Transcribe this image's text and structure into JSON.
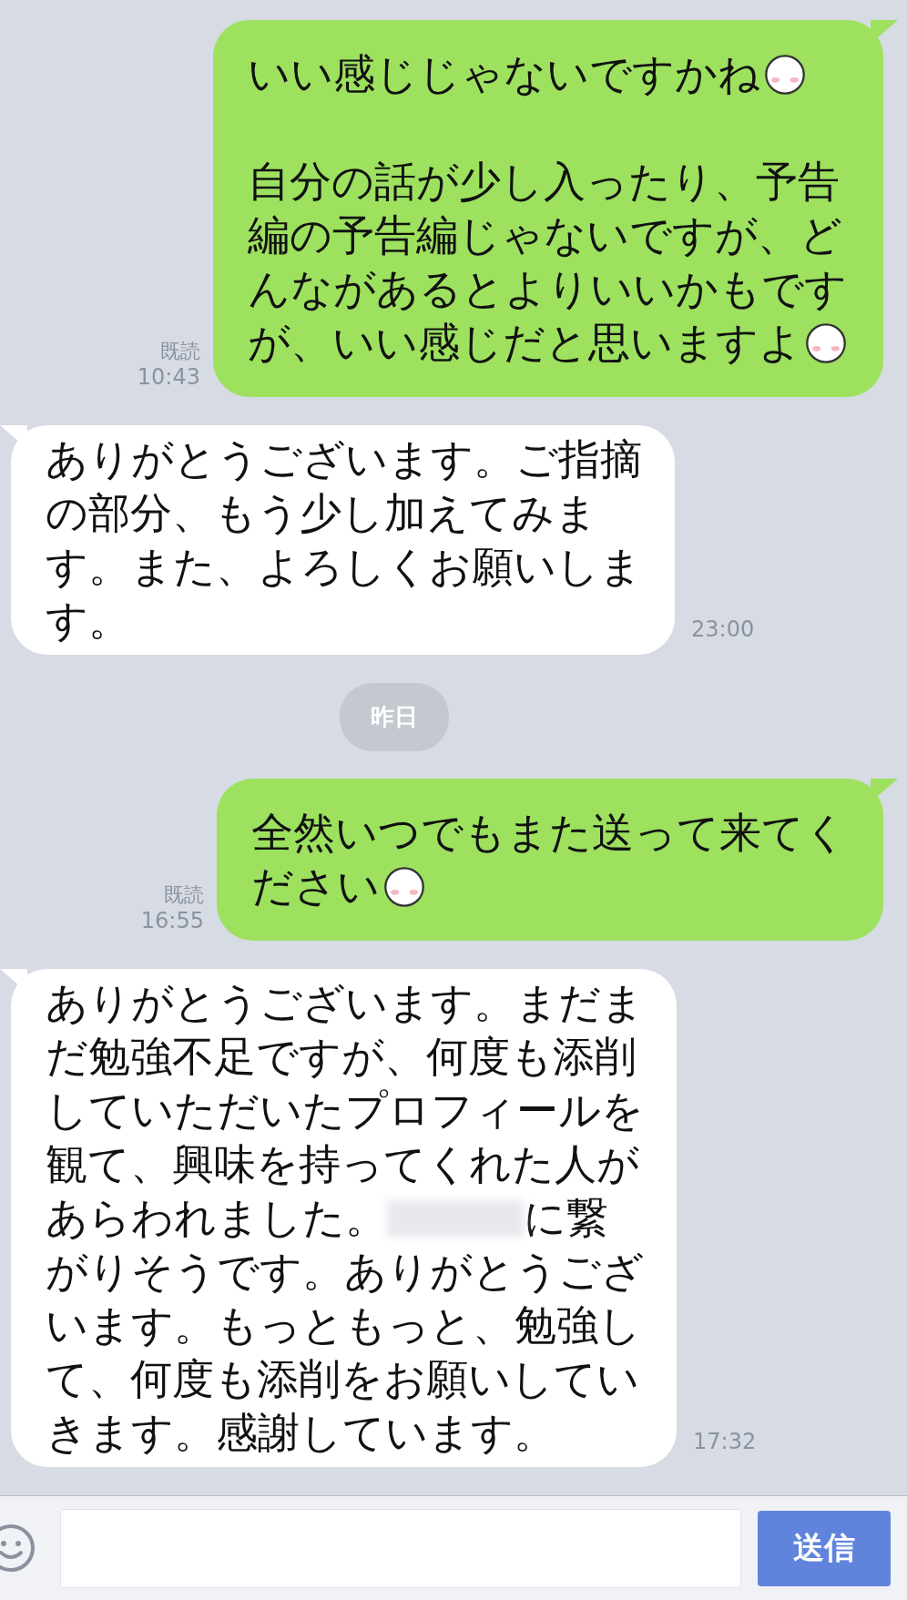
{
  "messages": [
    {
      "kind": "sent",
      "read": "既読",
      "time": "10:43",
      "paragraphs": [
        [
          [
            {
              "kind": "text",
              "text": "いい感じじゃないですかね"
            },
            {
              "kind": "sticker"
            }
          ]
        ],
        [
          [
            {
              "kind": "text",
              "text": "自分の話が少し入ったり、予告"
            }
          ],
          [
            {
              "kind": "text",
              "text": "編の予告編じゃないですが、ど"
            }
          ],
          [
            {
              "kind": "text",
              "text": "んながあるとよりいいかもです"
            }
          ],
          [
            {
              "kind": "text",
              "text": "が、いい感じだと思いますよ"
            },
            {
              "kind": "sticker"
            }
          ]
        ]
      ]
    },
    {
      "kind": "received",
      "time": "23:00",
      "paragraphs": [
        [
          [
            {
              "kind": "text",
              "text": "ありがとうございます。ご指摘"
            }
          ],
          [
            {
              "kind": "text",
              "text": "の部分、もう少し加えてみま"
            }
          ],
          [
            {
              "kind": "text",
              "text": "す。また、よろしくお願いしま"
            }
          ],
          [
            {
              "kind": "text",
              "text": "す。"
            }
          ]
        ]
      ]
    },
    {
      "kind": "date",
      "text": "昨日"
    },
    {
      "kind": "sent",
      "read": "既読",
      "time": "16:55",
      "paragraphs": [
        [
          [
            {
              "kind": "text",
              "text": "全然いつでもまた送って来てく"
            }
          ],
          [
            {
              "kind": "text",
              "text": "ださい"
            },
            {
              "kind": "sticker"
            }
          ]
        ]
      ]
    },
    {
      "kind": "received",
      "time": "17:32",
      "paragraphs": [
        [
          [
            {
              "kind": "text",
              "text": "ありがとうございます。まだま"
            }
          ],
          [
            {
              "kind": "text",
              "text": "だ勉強不足ですが、何度も添削"
            }
          ],
          [
            {
              "kind": "text",
              "text": "していただいたプロフィールを"
            }
          ],
          [
            {
              "kind": "text",
              "text": "観て、興味を持ってくれた人が"
            }
          ],
          [
            {
              "kind": "text",
              "text": "あらわれました。"
            },
            {
              "kind": "blur"
            },
            {
              "kind": "text",
              "text": "に繋"
            }
          ],
          [
            {
              "kind": "text",
              "text": "がりそうです。ありがとうござ"
            }
          ],
          [
            {
              "kind": "text",
              "text": "います。もっともっと、勉強し"
            }
          ],
          [
            {
              "kind": "text",
              "text": "て、何度も添削をお願いしてい"
            }
          ],
          [
            {
              "kind": "text",
              "text": "きます。感謝しています。"
            }
          ]
        ]
      ]
    }
  ],
  "composer": {
    "send_label": "送信"
  }
}
